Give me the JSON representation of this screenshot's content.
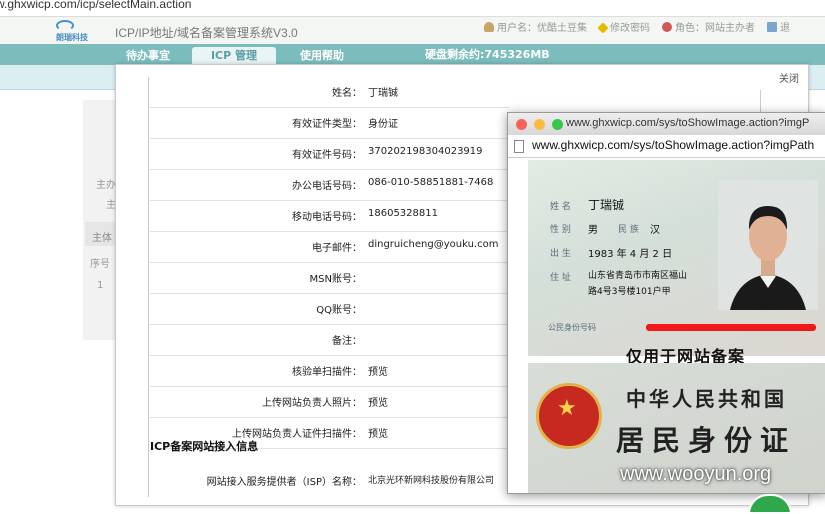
{
  "browser": {
    "url": "w.ghxwicp.com/icp/selectMain.action"
  },
  "header": {
    "logo_text": "朗瑞科技",
    "system_title": "ICP/IP地址/域名备案管理系统V3.0",
    "username": "用户名：优酷土豆集",
    "change_password": "修改密码",
    "role": "角色：网站主办者",
    "exit": "退"
  },
  "nav": {
    "tabs": [
      {
        "label": "待办事宜",
        "active": false
      },
      {
        "label": "ICP 管理",
        "active": true
      },
      {
        "label": "使用帮助",
        "active": false
      }
    ],
    "disk": "硬盘剩余约:745326MB"
  },
  "background": {
    "label_a": "主办",
    "label_b": "主",
    "label_c": "主体",
    "seq_header": "序号",
    "row1": "1"
  },
  "modal": {
    "close": "关闭",
    "rows": [
      {
        "label": "姓名：",
        "value": "丁瑞铖"
      },
      {
        "label": "有效证件类型：",
        "value": "身份证"
      },
      {
        "label": "有效证件号码：",
        "value": "370202198304023919"
      },
      {
        "label": "办公电话号码：",
        "value": "086-010-58851881-7468"
      },
      {
        "label": "移动电话号码：",
        "value": "18605328811"
      },
      {
        "label": "电子邮件：",
        "value": "dingruicheng@youku.com"
      },
      {
        "label": "MSN账号：",
        "value": ""
      },
      {
        "label": "QQ账号：",
        "value": ""
      },
      {
        "label": "备注：",
        "value": ""
      },
      {
        "label": "核验单扫描件：",
        "value": "预览"
      },
      {
        "label": "上传网站负责人照片：",
        "value": "预览"
      },
      {
        "label": "上传网站负责人证件扫描件：",
        "value": "预览"
      }
    ],
    "section_title": "ICP备案网站接入信息",
    "isp_label": "网站接入服务提供者（ISP）名称：",
    "isp_value": "北京光环新网科技股份有限公司"
  },
  "popup": {
    "title": "www.ghxwicp.com/sys/toShowImage.action?imgP",
    "url": "www.ghxwicp.com/sys/toShowImage.action?imgPath",
    "card_front": {
      "name_label": "姓 名",
      "name": "丁瑞铖",
      "sex_label": "性 别",
      "sex": "男",
      "nation_label": "民 族",
      "nation": "汉",
      "birth_label": "出 生",
      "birth": "1983 年 4 月 2 日",
      "addr_label": "住 址",
      "addr1": "山东省青岛市市南区福山",
      "addr2": "路4号3号楼101户甲",
      "id_label": "公民身份号码",
      "stamp": "仅用于网站备案"
    },
    "card_back": {
      "line1": "中华人民共和国",
      "line2": "居民身份证"
    }
  },
  "watermark": "www.wooyun.org",
  "colors": {
    "nav": "#7bbcbc",
    "redact": "#f01818"
  }
}
